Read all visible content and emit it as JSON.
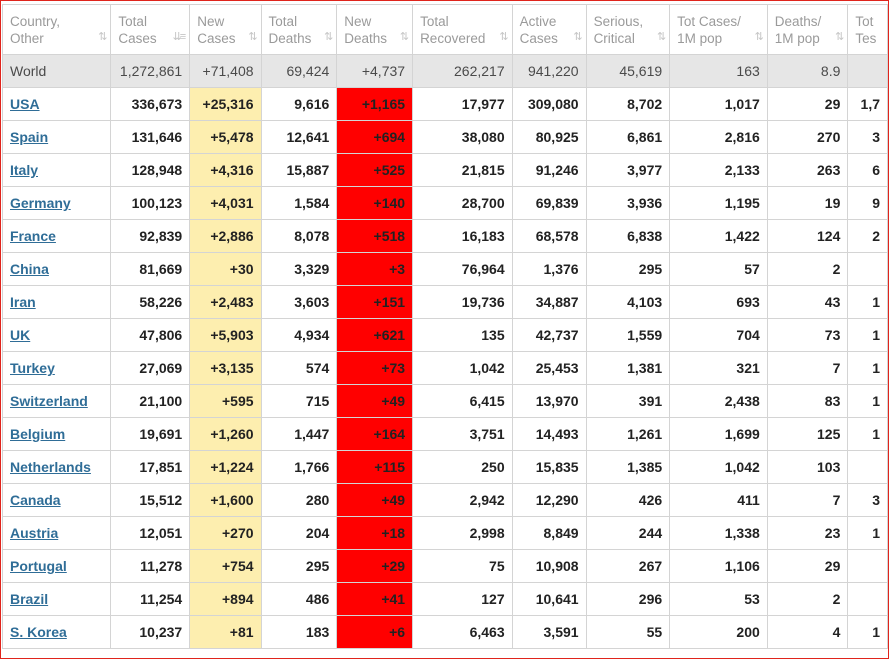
{
  "headers": [
    {
      "line1": "Country,",
      "line2": "Other"
    },
    {
      "line1": "Total",
      "line2": "Cases"
    },
    {
      "line1": "New",
      "line2": "Cases"
    },
    {
      "line1": "Total",
      "line2": "Deaths"
    },
    {
      "line1": "New",
      "line2": "Deaths"
    },
    {
      "line1": "Total",
      "line2": "Recovered"
    },
    {
      "line1": "Active",
      "line2": "Cases"
    },
    {
      "line1": "Serious,",
      "line2": "Critical"
    },
    {
      "line1": "Tot Cases/",
      "line2": "1M pop"
    },
    {
      "line1": "Deaths/",
      "line2": "1M pop"
    },
    {
      "line1": "Tot",
      "line2": "Tes"
    }
  ],
  "world": [
    "World",
    "1,272,861",
    "+71,408",
    "69,424",
    "+4,737",
    "262,217",
    "941,220",
    "45,619",
    "163",
    "8.9",
    ""
  ],
  "rows": [
    [
      "USA",
      "336,673",
      "+25,316",
      "9,616",
      "+1,165",
      "17,977",
      "309,080",
      "8,702",
      "1,017",
      "29",
      "1,7"
    ],
    [
      "Spain",
      "131,646",
      "+5,478",
      "12,641",
      "+694",
      "38,080",
      "80,925",
      "6,861",
      "2,816",
      "270",
      "3"
    ],
    [
      "Italy",
      "128,948",
      "+4,316",
      "15,887",
      "+525",
      "21,815",
      "91,246",
      "3,977",
      "2,133",
      "263",
      "6"
    ],
    [
      "Germany",
      "100,123",
      "+4,031",
      "1,584",
      "+140",
      "28,700",
      "69,839",
      "3,936",
      "1,195",
      "19",
      "9"
    ],
    [
      "France",
      "92,839",
      "+2,886",
      "8,078",
      "+518",
      "16,183",
      "68,578",
      "6,838",
      "1,422",
      "124",
      "2"
    ],
    [
      "China",
      "81,669",
      "+30",
      "3,329",
      "+3",
      "76,964",
      "1,376",
      "295",
      "57",
      "2",
      ""
    ],
    [
      "Iran",
      "58,226",
      "+2,483",
      "3,603",
      "+151",
      "19,736",
      "34,887",
      "4,103",
      "693",
      "43",
      "1"
    ],
    [
      "UK",
      "47,806",
      "+5,903",
      "4,934",
      "+621",
      "135",
      "42,737",
      "1,559",
      "704",
      "73",
      "1"
    ],
    [
      "Turkey",
      "27,069",
      "+3,135",
      "574",
      "+73",
      "1,042",
      "25,453",
      "1,381",
      "321",
      "7",
      "1"
    ],
    [
      "Switzerland",
      "21,100",
      "+595",
      "715",
      "+49",
      "6,415",
      "13,970",
      "391",
      "2,438",
      "83",
      "1"
    ],
    [
      "Belgium",
      "19,691",
      "+1,260",
      "1,447",
      "+164",
      "3,751",
      "14,493",
      "1,261",
      "1,699",
      "125",
      "1"
    ],
    [
      "Netherlands",
      "17,851",
      "+1,224",
      "1,766",
      "+115",
      "250",
      "15,835",
      "1,385",
      "1,042",
      "103",
      ""
    ],
    [
      "Canada",
      "15,512",
      "+1,600",
      "280",
      "+49",
      "2,942",
      "12,290",
      "426",
      "411",
      "7",
      "3"
    ],
    [
      "Austria",
      "12,051",
      "+270",
      "204",
      "+18",
      "2,998",
      "8,849",
      "244",
      "1,338",
      "23",
      "1"
    ],
    [
      "Portugal",
      "11,278",
      "+754",
      "295",
      "+29",
      "75",
      "10,908",
      "267",
      "1,106",
      "29",
      ""
    ],
    [
      "Brazil",
      "11,254",
      "+894",
      "486",
      "+41",
      "127",
      "10,641",
      "296",
      "53",
      "2",
      ""
    ],
    [
      "S. Korea",
      "10,237",
      "+81",
      "183",
      "+6",
      "6,463",
      "3,591",
      "55",
      "200",
      "4",
      "1"
    ]
  ],
  "sort_icons": [
    "sort-icon",
    "sort-desc-icon"
  ]
}
